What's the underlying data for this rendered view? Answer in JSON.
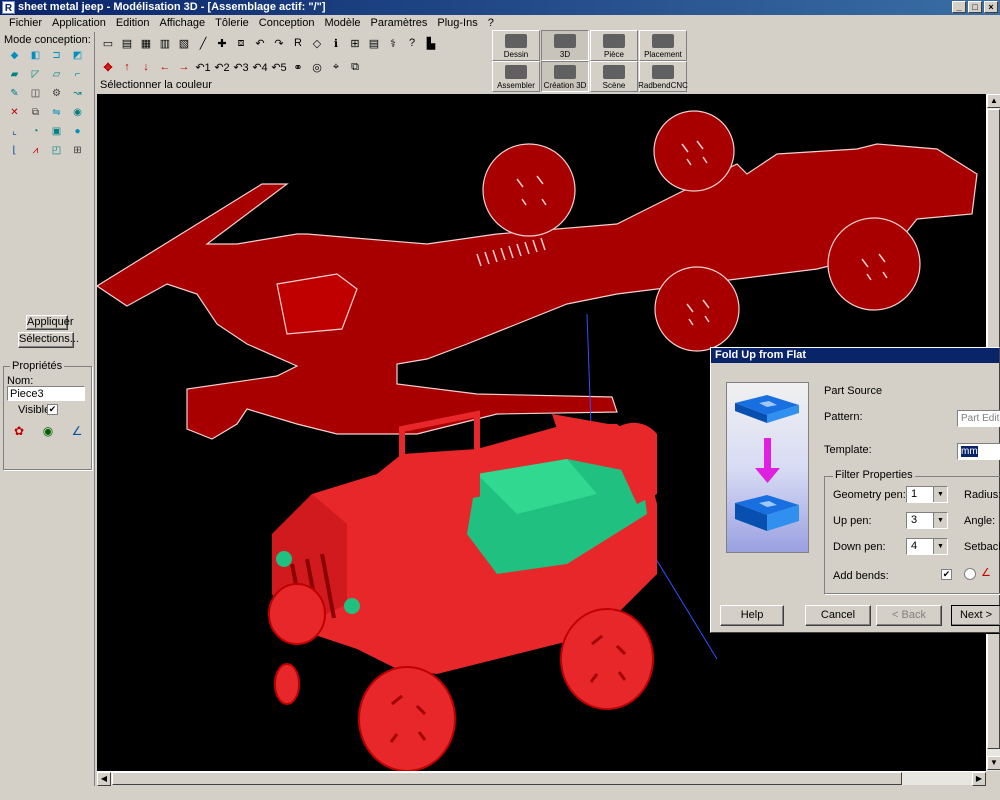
{
  "window": {
    "app_icon": "R",
    "title": "sheet metal jeep - Modélisation 3D - [Assemblage actif: \"/\"]",
    "controls": [
      "_",
      "□",
      "×"
    ]
  },
  "menu": [
    "Fichier",
    "Application",
    "Edition",
    "Affichage",
    "Tôlerie",
    "Conception",
    "Modèle",
    "Paramètres",
    "Plug-Ins",
    "?"
  ],
  "left_panel": {
    "mode_label": "Mode conception:",
    "tools": [
      {
        "icon": "box-icon",
        "glyph": "◆",
        "color": "#0090c0"
      },
      {
        "icon": "flange-icon",
        "glyph": "◧",
        "color": "#0090c0"
      },
      {
        "icon": "hem-icon",
        "glyph": "⊐",
        "color": "#0090c0"
      },
      {
        "icon": "cut-icon",
        "glyph": "◩",
        "color": "#0090c0"
      },
      {
        "icon": "sheet-icon",
        "glyph": "▰",
        "color": "#008080"
      },
      {
        "icon": "diagonal-icon",
        "glyph": "◸",
        "color": "#008080"
      },
      {
        "icon": "plane-icon",
        "glyph": "▱",
        "color": "#008080"
      },
      {
        "icon": "bend-icon",
        "glyph": "⌐",
        "color": "#0090c0"
      },
      {
        "icon": "pencil-icon",
        "glyph": "✎",
        "color": "#008080"
      },
      {
        "icon": "boxes-icon",
        "glyph": "◫",
        "color": "#404040"
      },
      {
        "icon": "gear-icon",
        "glyph": "⚙",
        "color": "#404040"
      },
      {
        "icon": "curve-icon",
        "glyph": "↝",
        "color": "#008080"
      },
      {
        "icon": "delete-icon",
        "glyph": "✕",
        "color": "#c00000"
      },
      {
        "icon": "copy-icon",
        "glyph": "⧉",
        "color": "#404040"
      },
      {
        "icon": "mirror-icon",
        "glyph": "⇋",
        "color": "#0090c0"
      },
      {
        "icon": "eye-icon",
        "glyph": "◉",
        "color": "#008080"
      },
      {
        "icon": "corner-icon",
        "glyph": "⌞",
        "color": "#0050a0"
      },
      {
        "icon": "tube-icon",
        "glyph": "◔",
        "color": "#008080"
      },
      {
        "icon": "cube-icon",
        "glyph": "▣",
        "color": "#008080"
      },
      {
        "icon": "dot-icon",
        "glyph": "●",
        "color": "#0090c0"
      },
      {
        "icon": "profile-icon",
        "glyph": "⌊",
        "color": "#0050a0"
      },
      {
        "icon": "hat-icon",
        "glyph": "⩘",
        "color": "#c00000"
      },
      {
        "icon": "box3d-icon",
        "glyph": "◰",
        "color": "#008080"
      },
      {
        "icon": "table-icon",
        "glyph": "⊞",
        "color": "#404040"
      }
    ],
    "apply_label": "Appliquer",
    "selections_label": "Sélections...",
    "props_legend": "Propriétés",
    "nom_label": "Nom:",
    "nom_value": "Piece3",
    "visible_label": "Visible:",
    "visible_checked": "✔",
    "prop_icons": [
      {
        "icon": "color-wheel-icon",
        "glyph": "✿",
        "color": "#c00000"
      },
      {
        "icon": "visibility-eye-icon",
        "glyph": "◉",
        "color": "#006000"
      },
      {
        "icon": "axis-icon",
        "glyph": "∠",
        "color": "#0050a0"
      }
    ]
  },
  "toolbar": {
    "row1": [
      {
        "icon": "new-icon",
        "glyph": "▭"
      },
      {
        "icon": "open-icon",
        "glyph": "▤"
      },
      {
        "icon": "save-icon",
        "glyph": "▦"
      },
      {
        "icon": "print-icon",
        "glyph": "▥"
      },
      {
        "icon": "preview-icon",
        "glyph": "▧"
      },
      {
        "icon": "line-icon",
        "glyph": "╱"
      },
      {
        "icon": "pin-icon",
        "glyph": "✚"
      },
      {
        "icon": "shapes-icon",
        "glyph": "⧈"
      },
      {
        "icon": "undo-icon",
        "glyph": "↶"
      },
      {
        "icon": "redo-icon",
        "glyph": "↷"
      },
      {
        "icon": "r-icon",
        "glyph": "R"
      },
      {
        "icon": "diamond-icon",
        "glyph": "◇"
      },
      {
        "icon": "info-icon",
        "glyph": "ℹ"
      },
      {
        "icon": "grid-icon",
        "glyph": "⊞"
      },
      {
        "icon": "sheet2-icon",
        "glyph": "▤"
      },
      {
        "icon": "wand-icon",
        "glyph": "⚕"
      },
      {
        "icon": "help-pointer-icon",
        "glyph": "?"
      },
      {
        "icon": "book-icon",
        "glyph": "▙"
      }
    ],
    "row2": [
      {
        "icon": "move-icon",
        "glyph": "✥"
      },
      {
        "icon": "arrow-up-icon",
        "glyph": "↑"
      },
      {
        "icon": "arrow-down-icon",
        "glyph": "↓"
      },
      {
        "icon": "arrow-left-icon",
        "glyph": "←"
      },
      {
        "icon": "arrow-right-icon",
        "glyph": "→"
      },
      {
        "icon": "step1-icon",
        "glyph": "↶1"
      },
      {
        "icon": "step2-icon",
        "glyph": "↶2"
      },
      {
        "icon": "step3-icon",
        "glyph": "↶3"
      },
      {
        "icon": "step4-icon",
        "glyph": "↶4"
      },
      {
        "icon": "step5-icon",
        "glyph": "↶5"
      },
      {
        "icon": "link-icon",
        "glyph": "⚭"
      },
      {
        "icon": "target-icon",
        "glyph": "◎"
      },
      {
        "icon": "snap-icon",
        "glyph": "⌖"
      },
      {
        "icon": "group-icon",
        "glyph": "⧉"
      }
    ],
    "hint": "Sélectionner la couleur"
  },
  "big_tabs": [
    {
      "label": "Dessin",
      "icon": "drawing-icon",
      "active": false
    },
    {
      "label": "3D",
      "icon": "3d-icon",
      "active": true
    },
    {
      "label": "Pièce",
      "icon": "part-icon",
      "active": false
    },
    {
      "label": "Placement",
      "icon": "placement-icon",
      "active": false
    },
    {
      "label": "Assembler",
      "icon": "assemble-icon",
      "active": false
    },
    {
      "label": "Création 3D",
      "icon": "create3d-icon",
      "active": true
    },
    {
      "label": "Scène",
      "icon": "camera-icon",
      "active": false
    },
    {
      "label": "RadbendCNC",
      "icon": "cnc-icon",
      "active": false
    }
  ],
  "dialog": {
    "title": "Fold Up from Flat",
    "part_source": "Part Source",
    "pattern_label": "Pattern:",
    "pattern_value": "Part Edit",
    "template_label": "Template:",
    "template_value": "mm",
    "filter_legend": "Filter Properties",
    "geometry_label": "Geometry pen:",
    "geometry_value": "1",
    "up_label": "Up pen:",
    "up_value": "3",
    "down_label": "Down pen:",
    "down_value": "4",
    "radius_label": "Radius:",
    "angle_label": "Angle:",
    "setback_label": "Setback:",
    "add_bends_label": "Add bends:",
    "add_bends_checked": "✔",
    "help_btn": "Help",
    "cancel_btn": "Cancel",
    "back_btn": "< Back",
    "next_btn": "Next >"
  },
  "colors": {
    "model_red": "#e8272a",
    "flat_red": "#a80000",
    "green_body": "#20c080",
    "title_blue": "#0a246a"
  }
}
